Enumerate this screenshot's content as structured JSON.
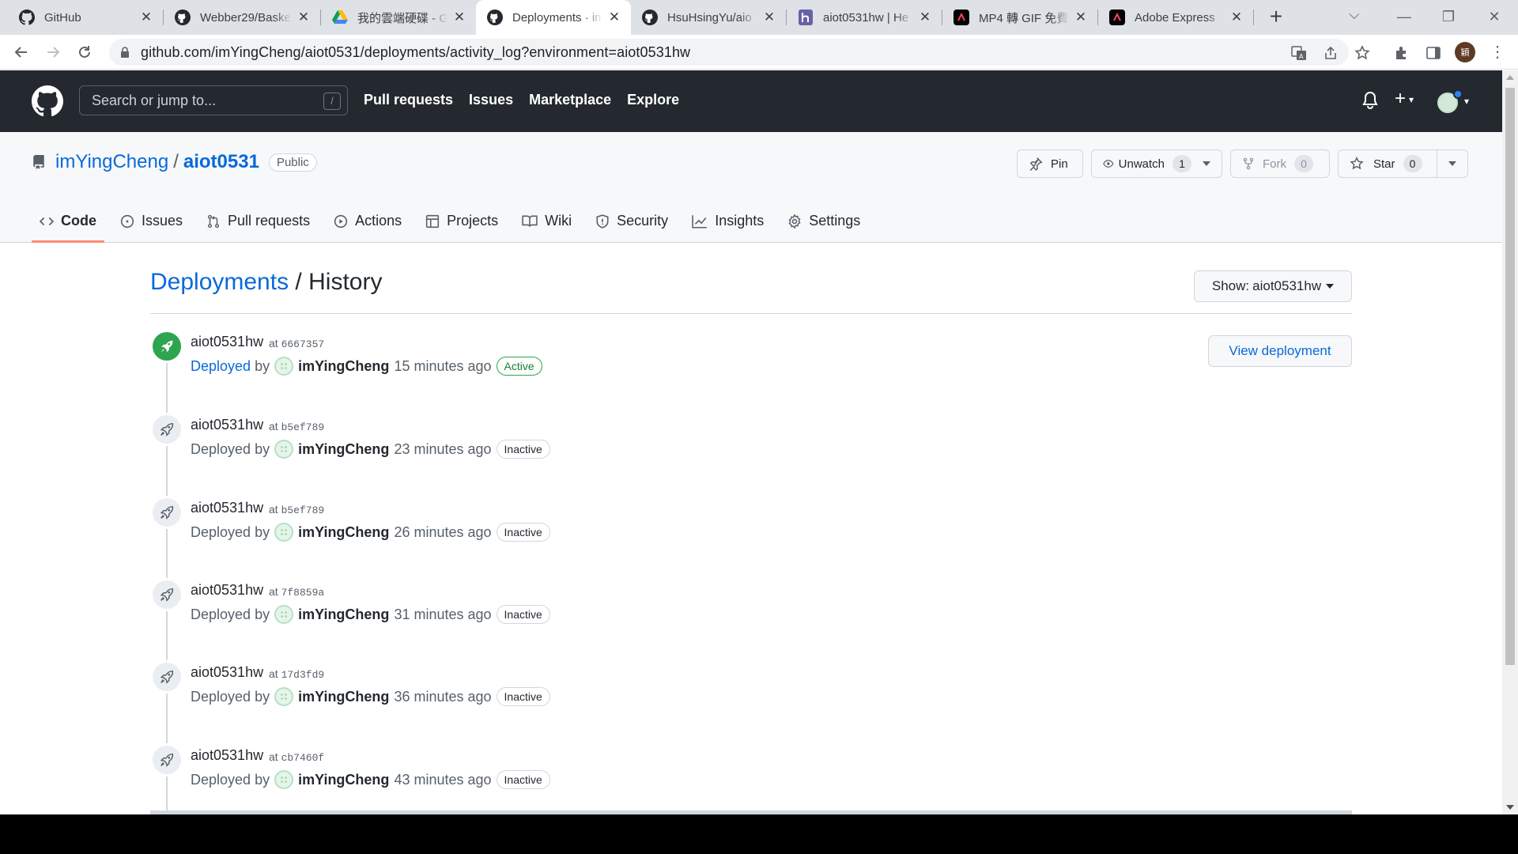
{
  "browser": {
    "tabs": [
      {
        "title": "GitHub",
        "icon": "github-icon"
      },
      {
        "title": "Webber29/Baske",
        "icon": "github-icon"
      },
      {
        "title": "我的雲端硬碟 - G",
        "icon": "google-drive-icon"
      },
      {
        "title": "Deployments · im",
        "icon": "github-icon"
      },
      {
        "title": "HsuHsingYu/aio",
        "icon": "github-icon"
      },
      {
        "title": "aiot0531hw | He",
        "icon": "heroku-icon"
      },
      {
        "title": "MP4 轉 GIF 免費",
        "icon": "adobe-express-icon"
      },
      {
        "title": "Adobe Express",
        "icon": "adobe-express-icon"
      }
    ],
    "active_tab": 3,
    "url": "github.com/imYingCheng/aiot0531/deployments/activity_log?environment=aiot0531hw",
    "profile_initial": "穎"
  },
  "github": {
    "search_placeholder": "Search or jump to...",
    "search_shortcut": "/",
    "nav": [
      "Pull requests",
      "Issues",
      "Marketplace",
      "Explore"
    ]
  },
  "repo": {
    "owner": "imYingCheng",
    "separator": "/",
    "name": "aiot0531",
    "visibility": "Public",
    "pin_label": "Pin",
    "watch_label": "Unwatch",
    "watch_count": "1",
    "fork_label": "Fork",
    "fork_count": "0",
    "star_label": "Star",
    "star_count": "0",
    "tabs": [
      "Code",
      "Issues",
      "Pull requests",
      "Actions",
      "Projects",
      "Wiki",
      "Security",
      "Insights",
      "Settings"
    ],
    "selected_tab": "Code"
  },
  "page": {
    "breadcrumb_link": "Deployments",
    "breadcrumb_sep": "/",
    "breadcrumb_current": "History",
    "show_label": "Show:",
    "show_value": "aiot0531hw",
    "view_deployment": "View deployment"
  },
  "deployments": [
    {
      "env": "aiot0531hw",
      "at": "at",
      "sha": "6667357",
      "deployed": "Deployed",
      "by": "by",
      "user": "imYingCheng",
      "time": "15 minutes ago",
      "status": "Active"
    },
    {
      "env": "aiot0531hw",
      "at": "at",
      "sha": "b5ef789",
      "deployed": "Deployed",
      "by": "by",
      "user": "imYingCheng",
      "time": "23 minutes ago",
      "status": "Inactive"
    },
    {
      "env": "aiot0531hw",
      "at": "at",
      "sha": "b5ef789",
      "deployed": "Deployed",
      "by": "by",
      "user": "imYingCheng",
      "time": "26 minutes ago",
      "status": "Inactive"
    },
    {
      "env": "aiot0531hw",
      "at": "at",
      "sha": "7f8859a",
      "deployed": "Deployed",
      "by": "by",
      "user": "imYingCheng",
      "time": "31 minutes ago",
      "status": "Inactive"
    },
    {
      "env": "aiot0531hw",
      "at": "at",
      "sha": "17d3fd9",
      "deployed": "Deployed",
      "by": "by",
      "user": "imYingCheng",
      "time": "36 minutes ago",
      "status": "Inactive"
    },
    {
      "env": "aiot0531hw",
      "at": "at",
      "sha": "cb7460f",
      "deployed": "Deployed",
      "by": "by",
      "user": "imYingCheng",
      "time": "43 minutes ago",
      "status": "Inactive"
    }
  ],
  "colors": {
    "header_bg": "#24292f",
    "link": "#0969da",
    "active_green": "#2da44e",
    "tab_underline": "#fd8c73"
  }
}
